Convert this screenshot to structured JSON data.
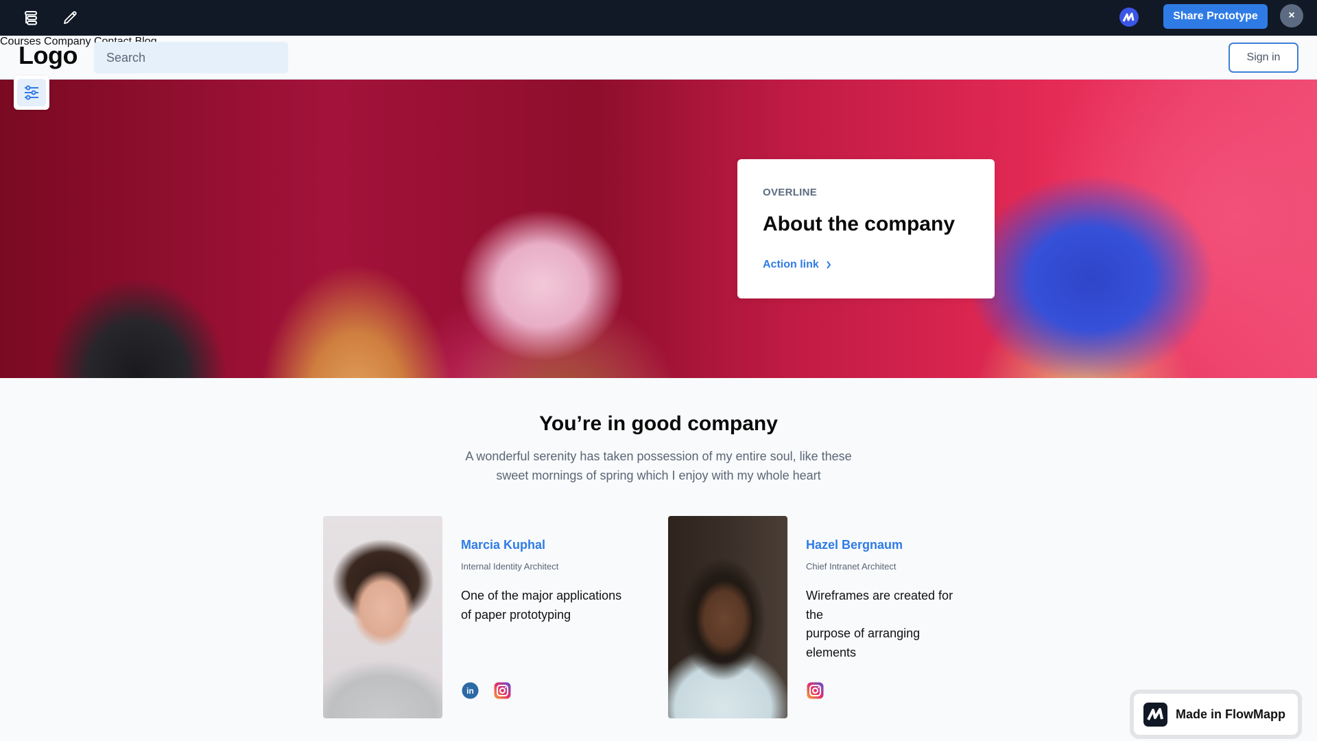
{
  "topbar": {
    "share_label": "Share Prototype",
    "close_label": "×",
    "icons": [
      "sitemap-icon",
      "pencil-icon",
      "flowmapp-logo-icon",
      "close-icon"
    ]
  },
  "header": {
    "logo": "Logo",
    "search_placeholder": "Search",
    "nav": [
      {
        "label": "Courses"
      },
      {
        "label": "Company"
      },
      {
        "label": "Contact"
      },
      {
        "label": "Blog"
      }
    ],
    "signin_label": "Sign in"
  },
  "hero": {
    "overline": "OVERLINE",
    "title": "About the company",
    "action_label": "Action link",
    "action_icon": "chevron-right-icon"
  },
  "section": {
    "title": "You’re in good company",
    "subtitle": "A wonderful serenity has taken possession of my entire soul, like these sweet mornings of spring which I enjoy with my whole heart"
  },
  "members": [
    {
      "name": "Marcia Kuphal",
      "role": "Internal Identity Architect",
      "quote": "One of the major applications of paper prototyping",
      "socials": [
        "linkedin-icon",
        "instagram-icon"
      ]
    },
    {
      "name": "Hazel Bergnaum",
      "role": "Chief Intranet Architect",
      "quote": "Wireframes are created for the\npurpose of arranging elements",
      "socials": [
        "instagram-icon"
      ]
    }
  ],
  "badge": {
    "label": "Made in FlowMapp"
  },
  "colors": {
    "accent": "#2f7be5",
    "topbar_bg": "#111826",
    "search_bg": "#e6f0fb",
    "page_bg": "#f8fafc"
  }
}
